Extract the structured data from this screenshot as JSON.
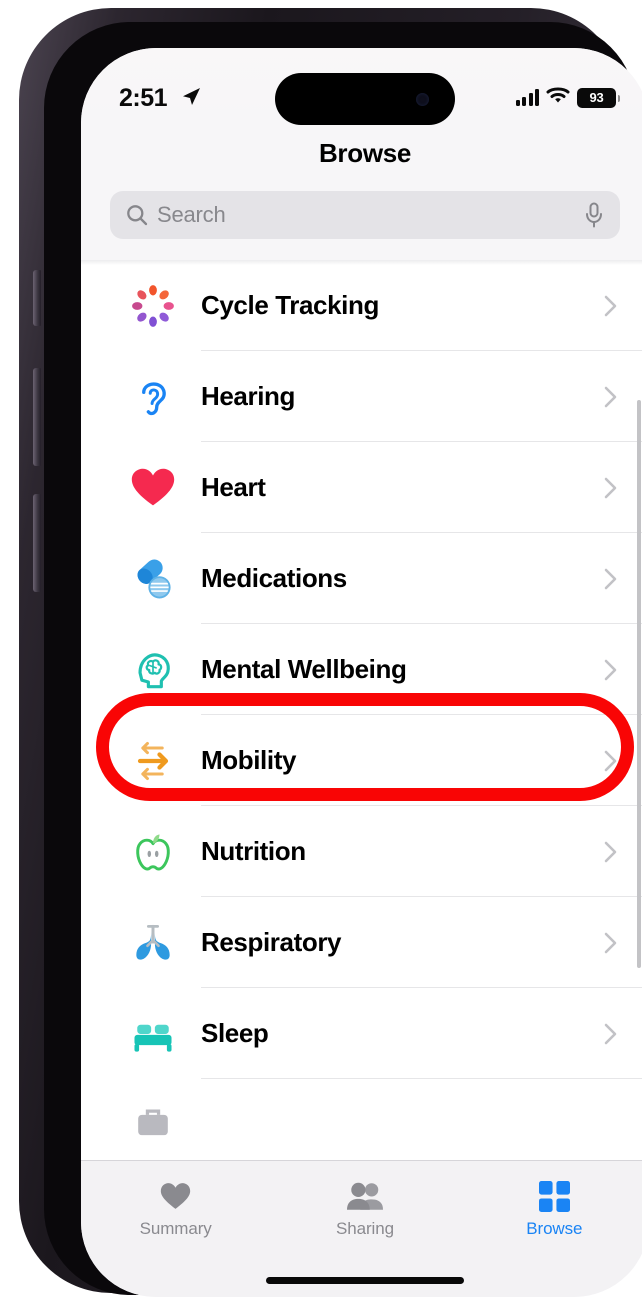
{
  "device": {
    "name": "iphone-14-pro",
    "frame_color": "#2c262f"
  },
  "status_bar": {
    "time": "2:51",
    "location_icon": "location-arrow-icon",
    "cellular_icon": "cellular-signal-icon",
    "wifi_icon": "wifi-icon",
    "battery_level": "93"
  },
  "header": {
    "title": "Browse"
  },
  "search": {
    "placeholder": "Search",
    "value": "",
    "search_icon": "search-icon",
    "mic_icon": "microphone-icon"
  },
  "list": {
    "items": [
      {
        "label": "",
        "icon": "body-measurements-icon",
        "color": "#a855e0",
        "partial": true
      },
      {
        "label": "Cycle Tracking",
        "icon": "cycle-tracking-icon",
        "color": "#f2552c"
      },
      {
        "label": "Hearing",
        "icon": "ear-icon",
        "color": "#1a84f4"
      },
      {
        "label": "Heart",
        "icon": "heart-icon",
        "color": "#f5294f"
      },
      {
        "label": "Medications",
        "icon": "medications-pill-icon",
        "color": "#3aa0e8"
      },
      {
        "label": "Mental Wellbeing",
        "icon": "brain-head-icon",
        "color": "#1fc0b0",
        "highlighted": true
      },
      {
        "label": "Mobility",
        "icon": "mobility-arrows-icon",
        "color": "#f0a02a"
      },
      {
        "label": "Nutrition",
        "icon": "apple-icon",
        "color": "#3cc65c"
      },
      {
        "label": "Respiratory",
        "icon": "lungs-icon",
        "color": "#2e9ae0"
      },
      {
        "label": "Sleep",
        "icon": "bed-icon",
        "color": "#17c4b6"
      },
      {
        "label": "",
        "icon": "symptoms-icon",
        "color": "#9a9aa0",
        "partial": true
      }
    ],
    "chevron_icon": "chevron-right-icon"
  },
  "annotation": {
    "shape": "rounded-rectangle",
    "color": "#f90505",
    "target": "Mental Wellbeing"
  },
  "tab_bar": {
    "tabs": [
      {
        "label": "Summary",
        "icon": "heart-icon",
        "active": false
      },
      {
        "label": "Sharing",
        "icon": "people-icon",
        "active": false
      },
      {
        "label": "Browse",
        "icon": "grid-squares-icon",
        "active": true
      }
    ],
    "active_color": "#1a84f4",
    "inactive_color": "#8a8a8f"
  }
}
